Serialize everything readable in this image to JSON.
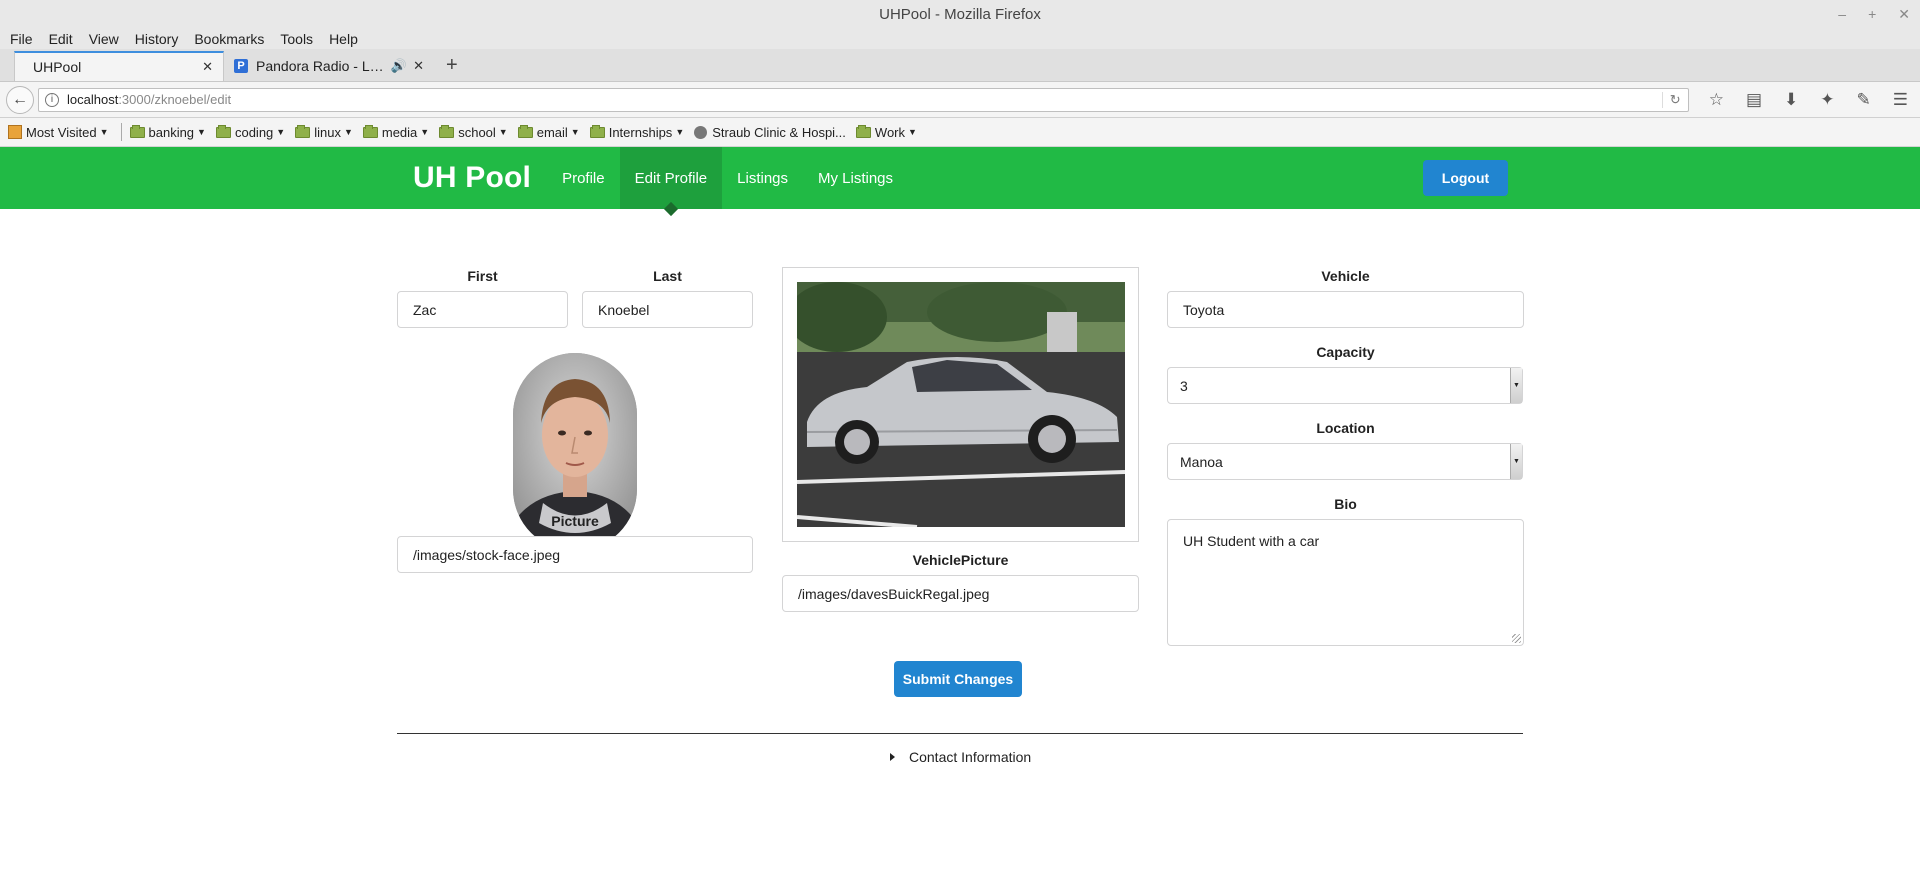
{
  "window": {
    "title": "UHPool - Mozilla Firefox"
  },
  "menu": [
    "File",
    "Edit",
    "View",
    "History",
    "Bookmarks",
    "Tools",
    "Help"
  ],
  "tabs": [
    {
      "title": "UHPool"
    },
    {
      "title": "Pandora Radio - Liste..."
    }
  ],
  "url": {
    "host": "localhost",
    "path": ":3000/zknoebel/edit"
  },
  "bookmarks": {
    "most_visited": "Most Visited",
    "folders": [
      "banking",
      "coding",
      "linux",
      "media",
      "school",
      "email",
      "Internships"
    ],
    "site": "Straub Clinic & Hospi...",
    "work": "Work"
  },
  "app": {
    "brand": "UH Pool",
    "nav": [
      "Profile",
      "Edit Profile",
      "Listings",
      "My Listings"
    ],
    "active_nav": "Edit Profile",
    "logout": "Logout"
  },
  "form": {
    "first_label": "First",
    "first_value": "Zac",
    "last_label": "Last",
    "last_value": "Knoebel",
    "picture_label": "Picture",
    "picture_value": "/images/stock-face.jpeg",
    "vehicle_picture_label": "VehiclePicture",
    "vehicle_picture_value": "/images/davesBuickRegal.jpeg",
    "vehicle_label": "Vehicle",
    "vehicle_value": "Toyota",
    "capacity_label": "Capacity",
    "capacity_value": "3",
    "location_label": "Location",
    "location_value": "Manoa",
    "bio_label": "Bio",
    "bio_value": "UH Student with a car",
    "submit": "Submit Changes",
    "contact": "Contact Information"
  },
  "colors": {
    "nav_green": "#21ba45",
    "button_blue": "#2185d0"
  }
}
